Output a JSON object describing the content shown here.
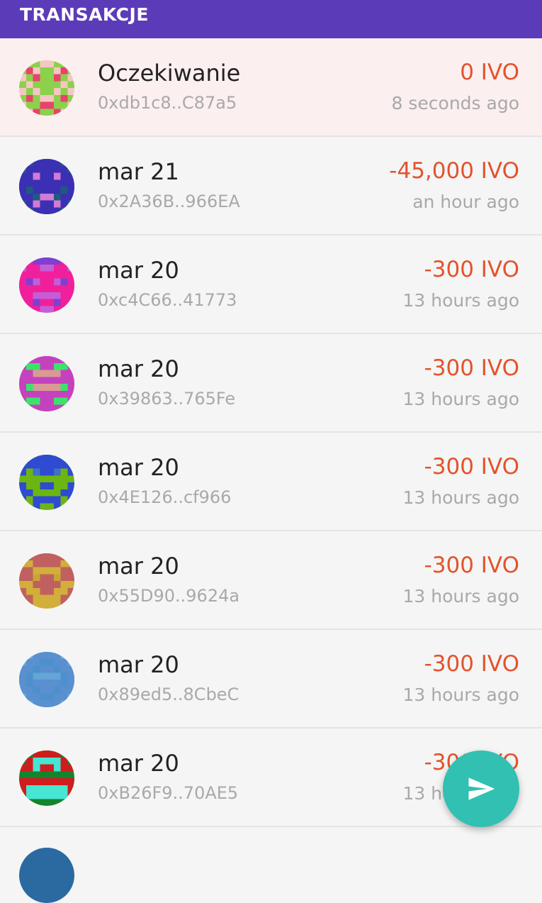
{
  "header": {
    "title": "TRANSAKCJE"
  },
  "transactions": [
    {
      "title": "Oczekiwanie",
      "address": "0xdb1c8..C87a5",
      "amount": "0 IVO",
      "time": "8 seconds ago",
      "pending": true,
      "avatar": {
        "bg": "#f4c7c3",
        "fg": "#8bd14b",
        "accent": "#e8436b"
      }
    },
    {
      "title": "mar 21",
      "address": "0x2A36B..966EA",
      "amount": "-45,000 IVO",
      "time": "an hour ago",
      "pending": false,
      "avatar": {
        "bg": "#1d5c7c",
        "fg": "#3b2fb4",
        "accent": "#d27ad6"
      }
    },
    {
      "title": "mar 20",
      "address": "0xc4C66..41773",
      "amount": "-300 IVO",
      "time": "13 hours ago",
      "pending": false,
      "avatar": {
        "bg": "#c45ed6",
        "fg": "#f11f9c",
        "accent": "#7f3fd0"
      }
    },
    {
      "title": "mar 20",
      "address": "0x39863..765Fe",
      "amount": "-300 IVO",
      "time": "13 hours ago",
      "pending": false,
      "avatar": {
        "bg": "#d89a94",
        "fg": "#c442bd",
        "accent": "#3be36b"
      }
    },
    {
      "title": "mar 20",
      "address": "0x4E126..cf966",
      "amount": "-300 IVO",
      "time": "13 hours ago",
      "pending": false,
      "avatar": {
        "bg": "#6db512",
        "fg": "#2e4bd1",
        "accent": "#3c74c4"
      }
    },
    {
      "title": "mar 20",
      "address": "0x55D90..9624a",
      "amount": "-300 IVO",
      "time": "13 hours ago",
      "pending": false,
      "avatar": {
        "bg": "#d2ae3a",
        "fg": "#c06060",
        "accent": "#c8a634"
      }
    },
    {
      "title": "mar 20",
      "address": "0x89ed5..8CbeC",
      "amount": "-300 IVO",
      "time": "13 hours ago",
      "pending": false,
      "avatar": {
        "bg": "#63a6d6",
        "fg": "#5a8fd0",
        "accent": "#4c90cc"
      }
    },
    {
      "title": "mar 20",
      "address": "0xB26F9..70AE5",
      "amount": "-300 IVO",
      "time": "13 hours ago",
      "pending": false,
      "avatar": {
        "bg": "#12842c",
        "fg": "#cf1d1d",
        "accent": "#46e6d2"
      }
    }
  ],
  "fab": {
    "icon": "send-icon",
    "color": "#31c0b2"
  }
}
